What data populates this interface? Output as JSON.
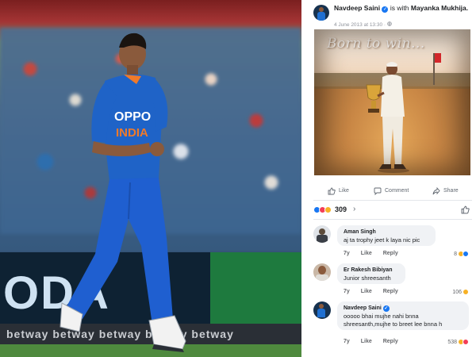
{
  "photo": {
    "board_text": "ODA",
    "strip_text": "betway  betway  betway  betway  betway",
    "jersey_sponsor": "OPPO",
    "jersey_country": "INDIA"
  },
  "post": {
    "author": "Navdeep Saini",
    "with_text": "is with",
    "tagged": "Mayanka Mukhija.",
    "timestamp": "4 June 2013 at 13:30 ·",
    "image_caption": "Born to win...",
    "actions": {
      "like": "Like",
      "comment": "Comment",
      "share": "Share"
    },
    "reaction_count": "309",
    "reaction_colors": [
      "#1877f2",
      "#f33e58",
      "#f7b125"
    ]
  },
  "comments": [
    {
      "name": "Aman Singh",
      "verified": false,
      "text": "aj ta trophy jeet k laya nic pic",
      "age": "7y",
      "like": "Like",
      "reply": "Reply",
      "count": "8"
    },
    {
      "name": "Er Rakesh Bibiyan",
      "verified": false,
      "text": "Junior shreesanth",
      "age": "7y",
      "like": "Like",
      "reply": "Reply",
      "count": "106"
    },
    {
      "name": "Navdeep Saini",
      "verified": true,
      "text_line1": "ooooo bhai mujhe nahi bnna",
      "text_line2": "shreesanth,mujhe to breet lee bnna h",
      "age": "7y",
      "like": "Like",
      "reply": "Reply",
      "count": "538"
    }
  ]
}
